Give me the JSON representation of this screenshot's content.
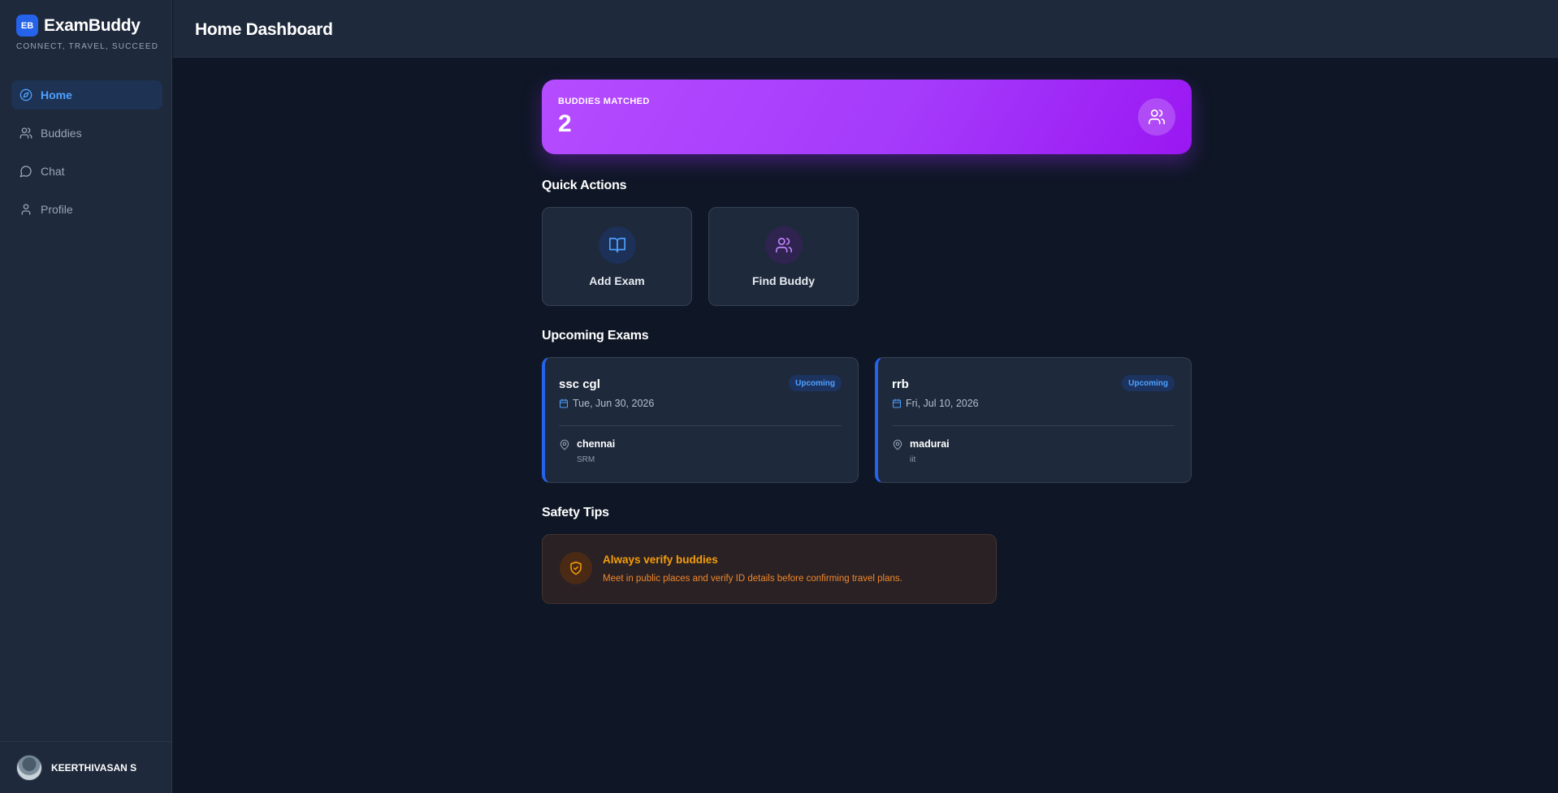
{
  "brand": {
    "logo": "EB",
    "name": "ExamBuddy",
    "tagline": "CONNECT, TRAVEL, SUCCEED"
  },
  "sidebar": {
    "items": [
      {
        "label": "Home",
        "icon": "compass-icon",
        "active": true
      },
      {
        "label": "Buddies",
        "icon": "users-icon",
        "active": false
      },
      {
        "label": "Chat",
        "icon": "chat-bubble-icon",
        "active": false
      },
      {
        "label": "Profile",
        "icon": "user-icon",
        "active": false
      }
    ],
    "user": {
      "name": "KEERTHIVASAN S"
    }
  },
  "header": {
    "title": "Home Dashboard"
  },
  "stats": {
    "label": "BUDDIES MATCHED",
    "value": "2",
    "icon": "users-icon"
  },
  "quick_actions": {
    "title": "Quick Actions",
    "items": [
      {
        "label": "Add Exam",
        "icon": "book-open-icon",
        "color": "#4ea1ff"
      },
      {
        "label": "Find Buddy",
        "icon": "users-icon",
        "color": "#c084fc"
      }
    ]
  },
  "upcoming": {
    "title": "Upcoming Exams",
    "exams": [
      {
        "name": "ssc cgl",
        "badge": "Upcoming",
        "date": "Tue, Jun 30, 2026",
        "city": "chennai",
        "venue": "SRM"
      },
      {
        "name": "rrb",
        "badge": "Upcoming",
        "date": "Fri, Jul 10, 2026",
        "city": "madurai",
        "venue": "iit"
      }
    ]
  },
  "safety": {
    "title": "Safety Tips",
    "tip_title": "Always verify buddies",
    "tip_text": "Meet in public places and verify ID details before confirming travel plans.",
    "icon": "shield-check-icon"
  },
  "colors": {
    "accent": "#2563eb",
    "stat_gradient_start": "#b54cff",
    "stat_gradient_end": "#9a17f2",
    "warning": "#f59e0b"
  }
}
